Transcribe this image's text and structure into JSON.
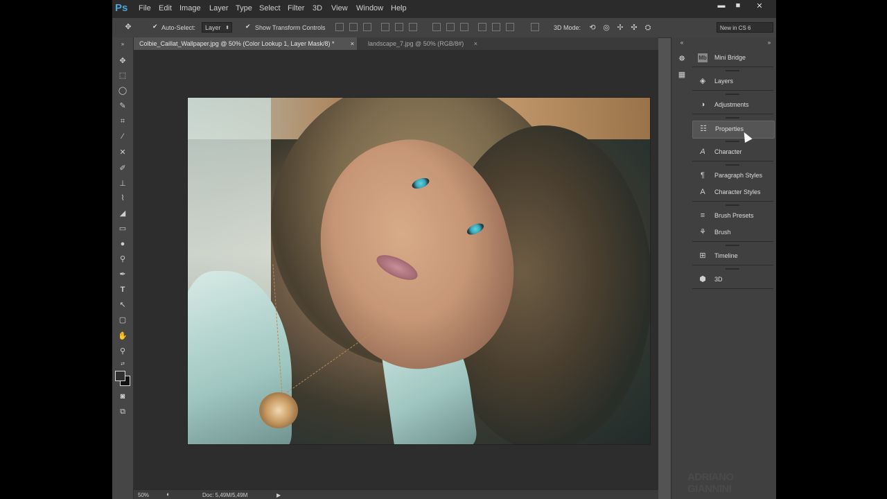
{
  "app": {
    "logo": "Ps"
  },
  "menu": [
    "File",
    "Edit",
    "Image",
    "Layer",
    "Type",
    "Select",
    "Filter",
    "3D",
    "View",
    "Window",
    "Help"
  ],
  "window_controls": {
    "minimize": "▬",
    "maximize": "■",
    "close": "✕"
  },
  "options_bar": {
    "auto_select_label": "Auto-Select:",
    "auto_select_checked": true,
    "auto_select_value": "Layer",
    "show_transform_label": "Show Transform Controls",
    "show_transform_checked": true,
    "mode_label": "3D Mode:",
    "workspace": "New in CS 6"
  },
  "tools": [
    "move-icon",
    "marquee-icon",
    "lasso-icon",
    "quick-select-icon",
    "crop-icon",
    "eyedropper-icon",
    "healing-icon",
    "brush-icon",
    "stamp-icon",
    "history-brush-icon",
    "eraser-icon",
    "gradient-icon",
    "blur-icon",
    "dodge-icon",
    "pen-icon",
    "type-icon",
    "path-select-icon",
    "shape-icon",
    "hand-icon",
    "zoom-icon"
  ],
  "tabs": [
    {
      "label": "Colbie_Caillat_Wallpaper.jpg @ 50% (Color Lookup 1, Layer Mask/8) *",
      "active": true
    },
    {
      "label": "landscape_7.jpg @ 50% (RGB/8#)",
      "active": false
    }
  ],
  "tab_close": "×",
  "status": {
    "zoom": "50%",
    "doc": "Doc: 5,49M/5,49M"
  },
  "panels": [
    {
      "label": "Mini Bridge",
      "icon": "mini-bridge-icon"
    },
    {
      "label": "Layers",
      "icon": "layers-icon"
    },
    {
      "label": "Adjustments",
      "icon": "adjustments-icon"
    },
    {
      "label": "Properties",
      "icon": "properties-icon",
      "highlighted": true
    },
    {
      "label": "Character",
      "icon": "character-icon"
    },
    {
      "label": "Paragraph Styles",
      "icon": "paragraph-styles-icon"
    },
    {
      "label": "Character Styles",
      "icon": "character-styles-icon"
    },
    {
      "label": "Brush Presets",
      "icon": "brush-presets-icon"
    },
    {
      "label": "Brush",
      "icon": "brush-panel-icon"
    },
    {
      "label": "Timeline",
      "icon": "timeline-icon"
    },
    {
      "label": "3D",
      "icon": "3d-icon"
    }
  ],
  "watermark": {
    "main": "ADRIANO GIANNINI",
    "sub": ""
  },
  "colors": {
    "accent": "#4ea3d9",
    "ui_dark": "#2b2b2b",
    "ui_mid": "#535353"
  }
}
